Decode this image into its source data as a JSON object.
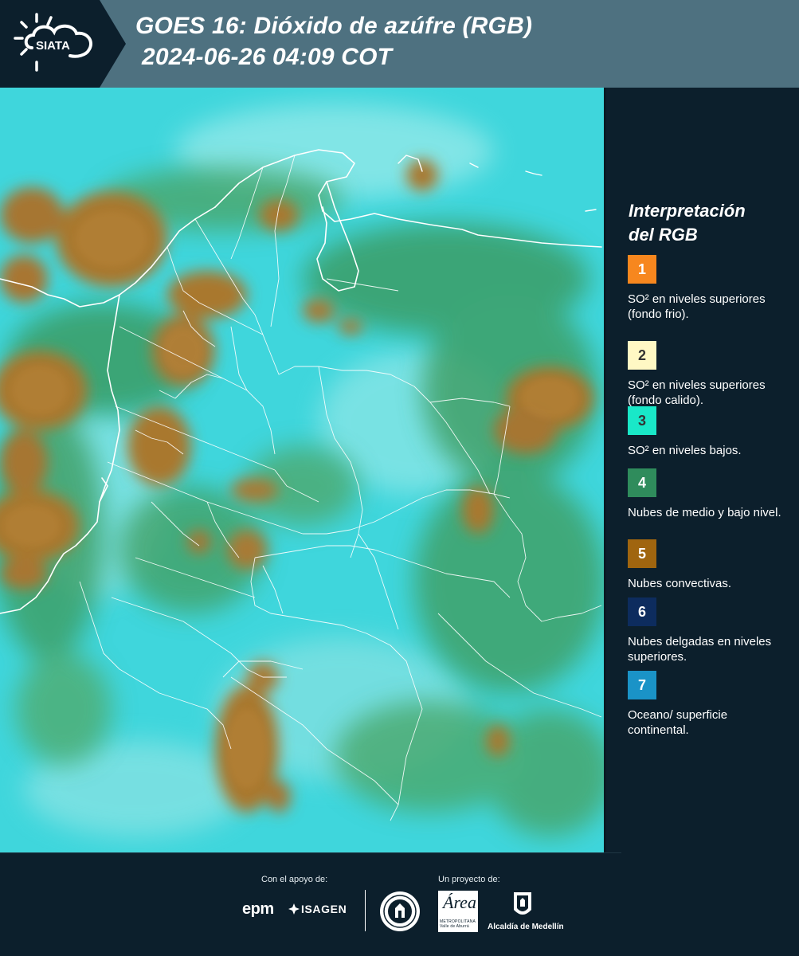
{
  "header": {
    "brand": "SIATA",
    "title_line1": "GOES 16: Dióxido de azúfre (RGB)",
    "title_line2": "2024-06-26 04:09 COT"
  },
  "map": {
    "product": "GOES 16 SO2 RGB composite",
    "background_color": "#3fd6dc",
    "convective_cloud_color": "#a9782e",
    "mid_low_cloud_color": "#3a9f60",
    "border_color": "#ffffff"
  },
  "legend": {
    "title_line1": "Interpretación",
    "title_line2": "del RGB",
    "items": [
      {
        "number": "1",
        "color": "#f7871e",
        "text_color": "#ffffff",
        "label": "SO² en niveles superiores (fondo frio)."
      },
      {
        "number": "2",
        "color": "#fff8c4",
        "text_color": "#333333",
        "label": "SO² en niveles superiores (fondo calido)."
      },
      {
        "number": "3",
        "color": "#19e8c8",
        "text_color": "#333333",
        "label": "SO² en niveles bajos."
      },
      {
        "number": "4",
        "color": "#2f8c5c",
        "text_color": "#ffffff",
        "label": "Nubes de medio y bajo nivel."
      },
      {
        "number": "5",
        "color": "#a0650f",
        "text_color": "#ffffff",
        "label": "Nubes convectivas."
      },
      {
        "number": "6",
        "color": "#0d2c5e",
        "text_color": "#ffffff",
        "label": "Nubes delgadas en niveles superiores."
      },
      {
        "number": "7",
        "color": "#1a93c7",
        "text_color": "#ffffff",
        "label": "Oceano/ superficie continental."
      }
    ]
  },
  "footer": {
    "support_label": "Con el apoyo de:",
    "project_label": "Un proyecto de:",
    "epm": "epm",
    "isagen": "ISAGEN",
    "area_word": "Área",
    "area_sub": "METROPOLITANA Valle de Aburrá",
    "alcaldia": "Alcaldía de Medellín"
  }
}
